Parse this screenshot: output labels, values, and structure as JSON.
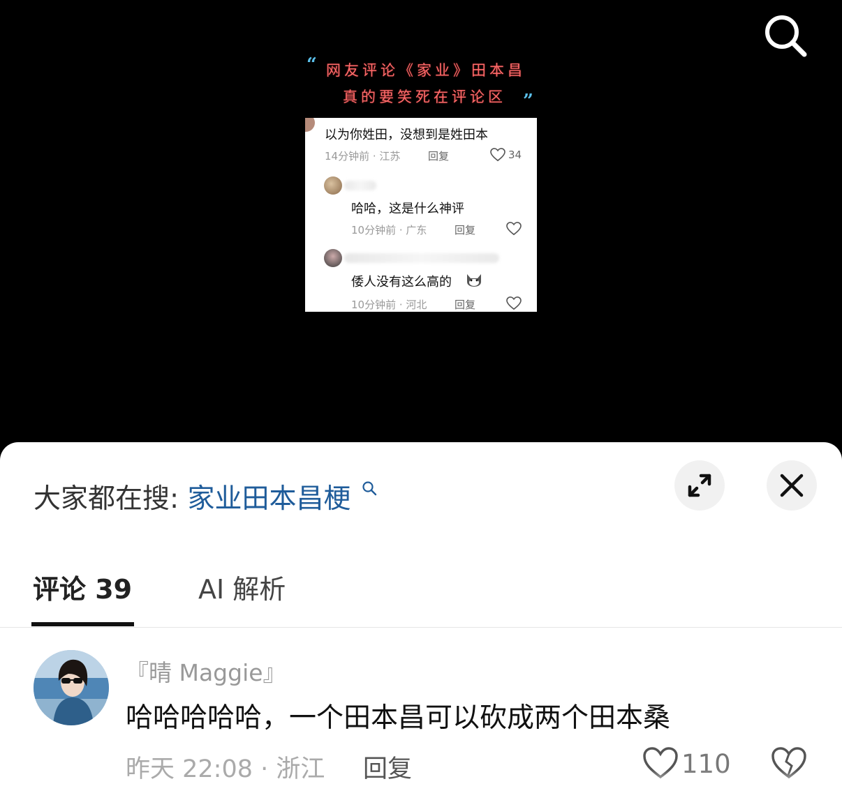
{
  "post": {
    "title_line1": "网友评论《家业》田本昌",
    "title_line2": "真的要笑死在评论区",
    "quote_open": "“",
    "quote_close": "”",
    "embedded_comments": [
      {
        "text": "以为你姓田，没想到是姓田本",
        "meta": "14分钟前 · 江苏",
        "reply": "回复",
        "likes": "34"
      },
      {
        "text": "哈哈，这是什么神评",
        "meta": "10分钟前 · 广东",
        "reply": "回复"
      },
      {
        "text": "倭人没有这么高的",
        "meta": "10分钟前 · 河北",
        "reply": "回复"
      }
    ]
  },
  "sheet": {
    "trending_label": "大家都在搜:",
    "trending_term": "家业田本昌梗",
    "tabs": [
      {
        "label": "评论 39",
        "active": true
      },
      {
        "label": "AI 解析",
        "active": false
      }
    ],
    "comment": {
      "author": "『晴 Maggie』",
      "text": "哈哈哈哈哈，一个田本昌可以砍成两个田本桑",
      "meta": "昨天 22:08 · 浙江",
      "reply": "回复",
      "likes": "110"
    }
  },
  "icons": {
    "search": "search-icon",
    "expand": "expand-icon",
    "close": "close-icon",
    "like": "heart-icon",
    "dislike": "broken-heart-icon"
  },
  "colors": {
    "trending_term": "#1f5c9a",
    "title_text": "#ff6b6b",
    "quote_marks": "#5bc0eb"
  }
}
